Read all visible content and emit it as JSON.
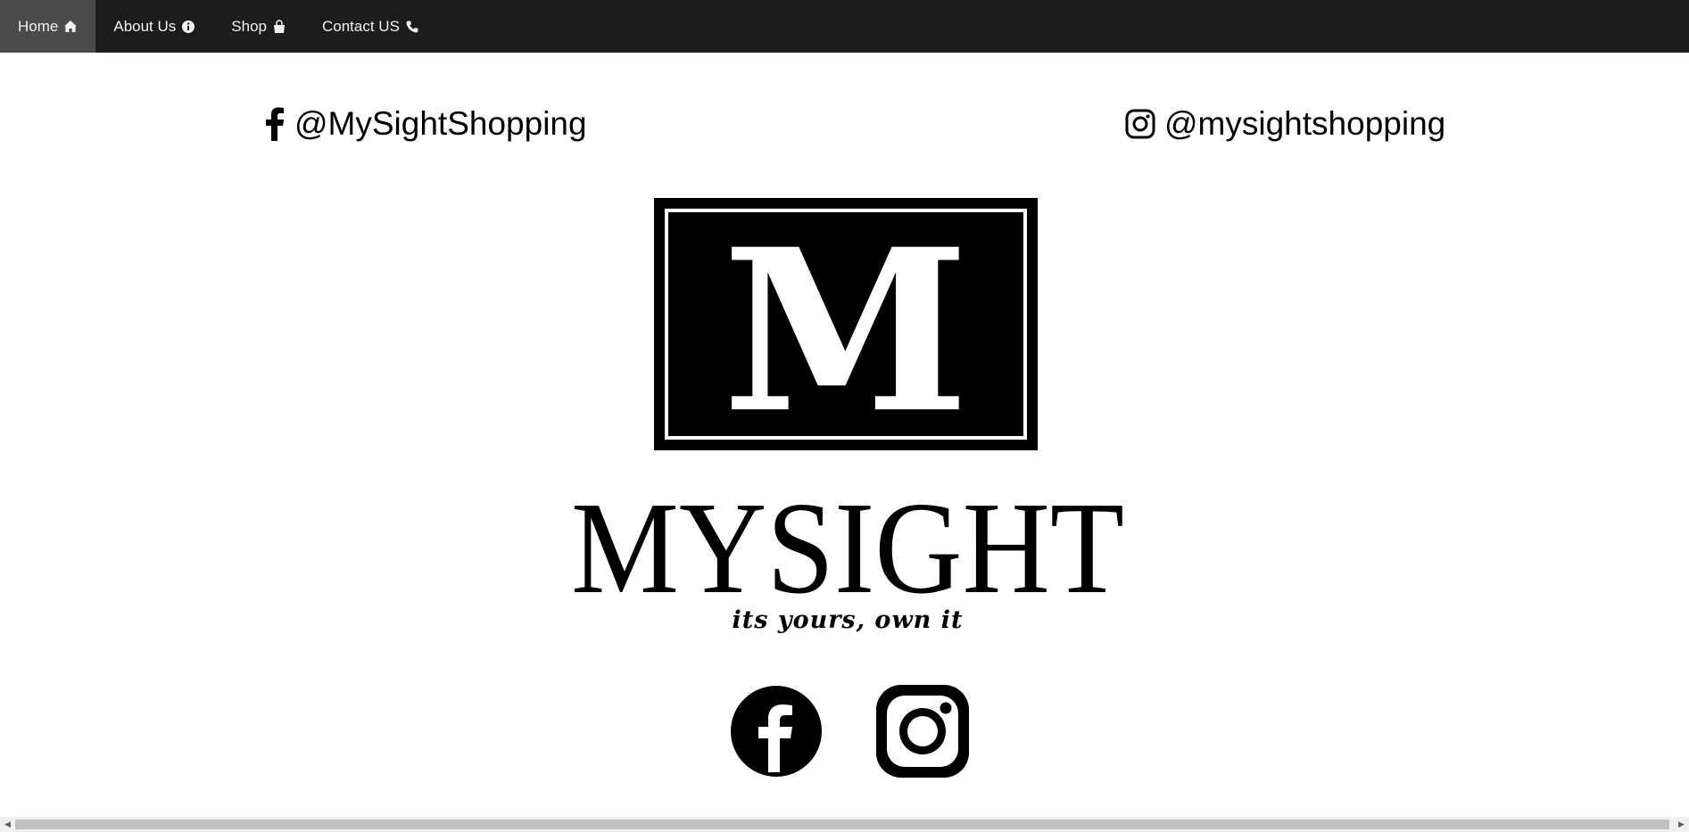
{
  "nav": {
    "items": [
      {
        "label": "Home",
        "icon": "home-icon",
        "active": true
      },
      {
        "label": "About Us",
        "icon": "info-icon",
        "active": false
      },
      {
        "label": "Shop",
        "icon": "shopping-bag-icon",
        "active": false
      },
      {
        "label": "Contact US",
        "icon": "phone-icon",
        "active": false
      }
    ]
  },
  "social": {
    "facebook_handle": "@MySightShopping",
    "instagram_handle": "@mysightshopping"
  },
  "brand": {
    "monogram": "M",
    "name": "MYSIGHT",
    "tagline": "its yours, own it"
  },
  "colors": {
    "nav_bg": "#1c1c1c",
    "nav_active_bg": "#4a4a4a",
    "nav_text": "#f2f2f2",
    "page_bg": "#ffffff",
    "ink": "#000000"
  }
}
